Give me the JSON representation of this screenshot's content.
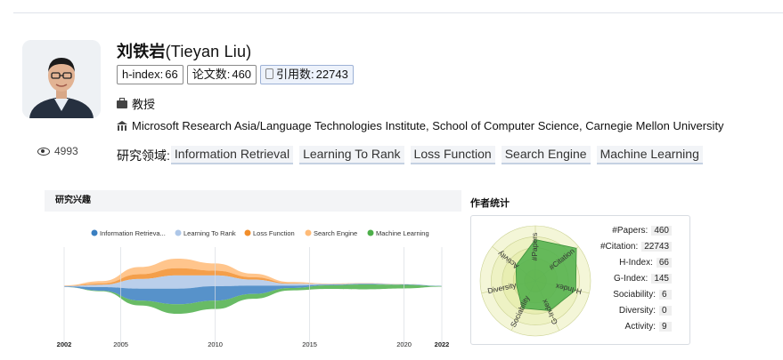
{
  "profile": {
    "name_cn": "刘铁岩",
    "name_en": "(Tieyan Liu)",
    "view_count": "4993",
    "badges": {
      "hindex_label": "h-index:",
      "hindex_value": "66",
      "papers_label": "论文数:",
      "papers_value": "460",
      "citations_label": "引用数:",
      "citations_value": "22743"
    },
    "title": "教授",
    "affiliation": "Microsoft Research Asia/Language Technologies Institute, School of Computer Science, Carnegie Mellon University",
    "fields_label": "研究领域:",
    "fields": [
      "Information Retrieval",
      "Learning To Rank",
      "Loss Function",
      "Search Engine",
      "Machine Learning"
    ]
  },
  "interests_panel": {
    "title": "研究兴趣"
  },
  "chart_data": [
    {
      "type": "area",
      "subtype": "streamgraph",
      "x": [
        2002,
        2004,
        2006,
        2008,
        2010,
        2012,
        2014,
        2016,
        2018,
        2020,
        2022
      ],
      "x_tick_labels": [
        "2002",
        "2005",
        "2010",
        "2015",
        "2020",
        "2022"
      ],
      "legend_position": "top",
      "series": [
        {
          "name": "Information Retrieva...",
          "color": "#3a7fc1",
          "values": [
            0.5,
            3,
            10,
            13,
            12,
            7,
            2,
            0.5,
            0.5,
            0.3,
            0.2
          ]
        },
        {
          "name": "Learning To Rank",
          "color": "#aec7e8",
          "values": [
            0.3,
            2,
            8,
            11,
            9,
            5,
            1.5,
            0.5,
            0.3,
            0.2,
            0.1
          ]
        },
        {
          "name": "Loss Function",
          "color": "#f28e2b",
          "values": [
            0.2,
            1,
            4,
            6,
            4,
            2,
            0.5,
            0.2,
            0.1,
            0.1,
            0
          ]
        },
        {
          "name": "Search Engine",
          "color": "#ffbb78",
          "values": [
            0.3,
            2,
            6,
            8,
            6,
            3,
            1,
            0.3,
            0.2,
            0.1,
            0
          ]
        },
        {
          "name": "Machine Learning",
          "color": "#4daf4a",
          "values": [
            0,
            0.5,
            4,
            8,
            7,
            4,
            2,
            3,
            4,
            3,
            0.5
          ]
        }
      ]
    },
    {
      "type": "radar",
      "axes": [
        "#Papers",
        "#Citation",
        "H-Index",
        "G-Index",
        "Sociability",
        "Diversity",
        "Activity"
      ],
      "values": [
        0.75,
        0.95,
        0.75,
        0.6,
        0.55,
        0.35,
        0.45
      ],
      "color": "#4daf4a"
    }
  ],
  "stats_panel": {
    "title": "作者统计",
    "rows": [
      {
        "label": "#Papers:",
        "value": "460"
      },
      {
        "label": "#Citation:",
        "value": "22743"
      },
      {
        "label": "H-Index:",
        "value": "66"
      },
      {
        "label": "G-Index:",
        "value": "145"
      },
      {
        "label": "Sociability:",
        "value": "6"
      },
      {
        "label": "Diversity:",
        "value": "0"
      },
      {
        "label": "Activity:",
        "value": "9"
      }
    ]
  }
}
